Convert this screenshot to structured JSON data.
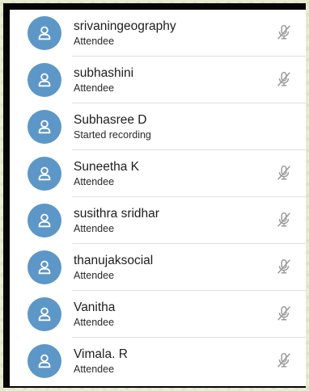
{
  "participants": [
    {
      "name": "srivaningeography",
      "status": "Attendee",
      "icon": "muted-mic-icon"
    },
    {
      "name": "subhashini",
      "status": "Attendee",
      "icon": "muted-mic-icon"
    },
    {
      "name": "Subhasree D",
      "status": "Started recording",
      "icon": ""
    },
    {
      "name": "Suneetha K",
      "status": "Attendee",
      "icon": "muted-mic-icon"
    },
    {
      "name": "susithra sridhar",
      "status": "Attendee",
      "icon": "muted-mic-icon"
    },
    {
      "name": "thanujaksocial",
      "status": "Attendee",
      "icon": "muted-mic-icon"
    },
    {
      "name": "Vanitha",
      "status": "Attendee",
      "icon": "muted-mic-icon"
    },
    {
      "name": "Vimala. R",
      "status": "Attendee",
      "icon": "muted-mic-icon"
    }
  ],
  "colors": {
    "avatar": "#5d97c8",
    "text": "#1d1d1d",
    "mic": "#9a9a9a"
  }
}
